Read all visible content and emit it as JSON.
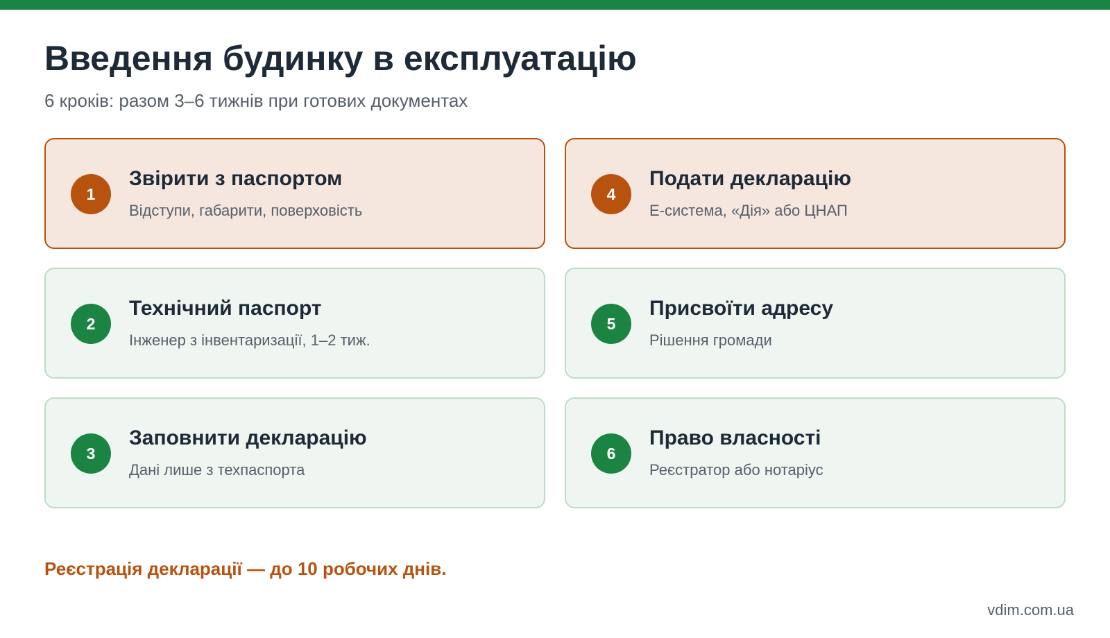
{
  "colors": {
    "top_bar": "#1b8443",
    "accent": "#b8520f",
    "accent_bg": "#f5e6de",
    "green": "#1b8443",
    "green_bg": "#eff6f1",
    "green_border": "#bcdcc6"
  },
  "title": "Введення будинку в експлуатацію",
  "subtitle": "6 кроків: разом 3–6 тижнів при готових документах",
  "steps": [
    {
      "number": "1",
      "title": "Звірити з паспортом",
      "description": "Відступи, габарити, поверховість",
      "highlighted": true
    },
    {
      "number": "2",
      "title": "Технічний паспорт",
      "description": "Інженер з інвентаризації, 1–2 тиж.",
      "highlighted": false
    },
    {
      "number": "3",
      "title": "Заповнити декларацію",
      "description": "Дані лише з техпаспорта",
      "highlighted": false
    },
    {
      "number": "4",
      "title": "Подати декларацію",
      "description": "Е-система, «Дія» або ЦНАП",
      "highlighted": true
    },
    {
      "number": "5",
      "title": "Присвоїти адресу",
      "description": "Рішення громади",
      "highlighted": false
    },
    {
      "number": "6",
      "title": "Право власності",
      "description": "Реєстратор або нотаріус",
      "highlighted": false
    }
  ],
  "footer_note": "Реєстрація декларації — до 10 робочих днів.",
  "site": "vdim.com.ua"
}
